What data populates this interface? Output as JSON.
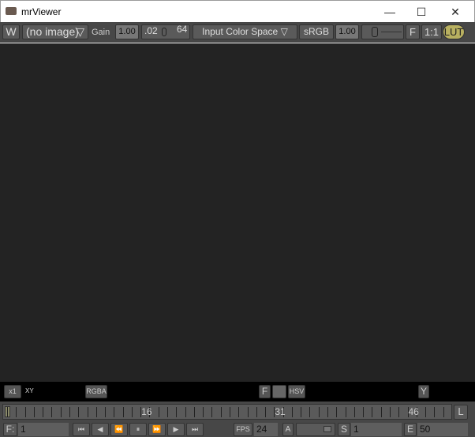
{
  "window": {
    "title": "mrViewer",
    "minimize": "—",
    "maximize": "☐",
    "close": "✕"
  },
  "toolbar": {
    "w": "W",
    "image": "(no image)",
    "image_arrow": "▽",
    "gain_label": "Gain",
    "gain": "1.00",
    "range_min": ".02",
    "range_max": "64",
    "input_cs": "Input Color Space",
    "input_cs_arrow": "▽",
    "display": "sRGB",
    "gamma": "1.00",
    "f": "F",
    "ratio": "1:1",
    "lut": "LUT"
  },
  "pixelbar": {
    "zoom": "x1",
    "coords": "XY",
    "rgba": "RGBA",
    "f": "F",
    "hsv": "HSV",
    "y": "Y"
  },
  "timeline": {
    "start": 1,
    "end": 50,
    "labels": [
      "16",
      "31",
      "46"
    ],
    "loop": "L"
  },
  "controls": {
    "frame_label": "F:",
    "frame": "1",
    "fps_label": "FPS",
    "fps": "24",
    "a": "A",
    "s_label": "S",
    "start": "1",
    "e_label": "E",
    "end": "50",
    "transport": [
      "⏮",
      "◀",
      "⏪",
      "⏸",
      "⏩",
      "▶",
      "⏭"
    ]
  }
}
